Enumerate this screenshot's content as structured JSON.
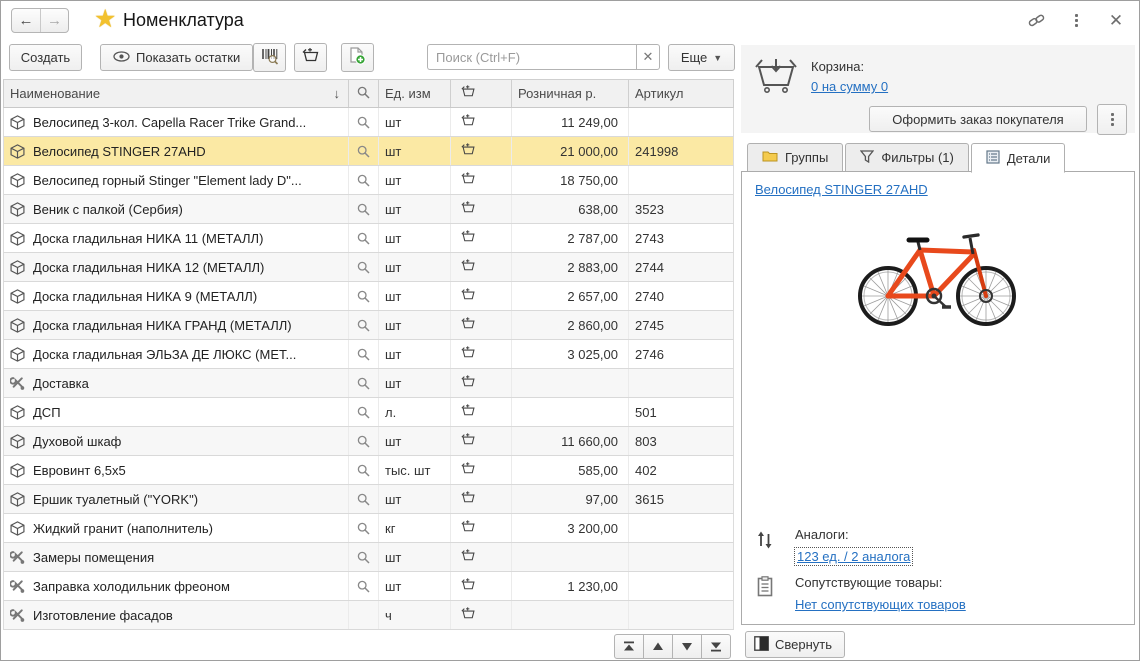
{
  "titlebar": {
    "title": "Номенклатура"
  },
  "toolbar": {
    "create_label": "Создать",
    "show_stock_label": "Показать остатки",
    "search_placeholder": "Поиск (Ctrl+F)",
    "search_value": "",
    "more_label": "Еще"
  },
  "table": {
    "headers": {
      "name": "Наименование",
      "unit": "Ед. изм",
      "price": "Розничная р.",
      "article": "Артикул"
    },
    "rows": [
      {
        "type": "good",
        "name": "Велосипед 3-кол. Capella Racer Trike Grand...",
        "unit": "шт",
        "price": "11 249,00",
        "article": "",
        "search": true,
        "selected": false
      },
      {
        "type": "good",
        "name": "Велосипед STINGER 27AHD",
        "unit": "шт",
        "price": "21 000,00",
        "article": "241998",
        "search": true,
        "selected": true
      },
      {
        "type": "good",
        "name": "Велосипед горный Stinger \"Element lady D\"...",
        "unit": "шт",
        "price": "18 750,00",
        "article": "",
        "search": true,
        "selected": false
      },
      {
        "type": "good",
        "name": "Веник с палкой (Сербия)",
        "unit": "шт",
        "price": "638,00",
        "article": "3523",
        "search": true,
        "selected": false
      },
      {
        "type": "good",
        "name": "Доска гладильная  НИКА 11 (МЕТАЛЛ)",
        "unit": "шт",
        "price": "2 787,00",
        "article": "2743",
        "search": true,
        "selected": false
      },
      {
        "type": "good",
        "name": "Доска гладильная  НИКА 12 (МЕТАЛЛ)",
        "unit": "шт",
        "price": "2 883,00",
        "article": "2744",
        "search": true,
        "selected": false
      },
      {
        "type": "good",
        "name": "Доска гладильная  НИКА 9 (МЕТАЛЛ)",
        "unit": "шт",
        "price": "2 657,00",
        "article": "2740",
        "search": true,
        "selected": false
      },
      {
        "type": "good",
        "name": "Доска гладильная  НИКА ГРАНД (МЕТАЛЛ)",
        "unit": "шт",
        "price": "2 860,00",
        "article": "2745",
        "search": true,
        "selected": false
      },
      {
        "type": "good",
        "name": "Доска гладильная  ЭЛЬЗА ДЕ ЛЮКС (МЕТ...",
        "unit": "шт",
        "price": "3 025,00",
        "article": "2746",
        "search": true,
        "selected": false
      },
      {
        "type": "service",
        "name": "Доставка",
        "unit": "шт",
        "price": "",
        "article": "",
        "search": true,
        "selected": false
      },
      {
        "type": "good",
        "name": "ДСП",
        "unit": "л.",
        "price": "",
        "article": "501",
        "search": true,
        "selected": false
      },
      {
        "type": "good",
        "name": "Духовой шкаф",
        "unit": "шт",
        "price": "11 660,00",
        "article": "803",
        "search": true,
        "selected": false
      },
      {
        "type": "good",
        "name": "Евровинт 6,5х5",
        "unit": "тыс. шт",
        "price": "585,00",
        "article": "402",
        "search": true,
        "selected": false
      },
      {
        "type": "good",
        "name": "Ершик туалетный (\"YORK\")",
        "unit": "шт",
        "price": "97,00",
        "article": "3615",
        "search": true,
        "selected": false
      },
      {
        "type": "good",
        "name": "Жидкий гранит (наполнитель)",
        "unit": "кг",
        "price": "3 200,00",
        "article": "",
        "search": true,
        "selected": false
      },
      {
        "type": "service",
        "name": "Замеры помещения",
        "unit": "шт",
        "price": "",
        "article": "",
        "search": true,
        "selected": false
      },
      {
        "type": "service",
        "name": "Заправка холодильник фреоном",
        "unit": "шт",
        "price": "1 230,00",
        "article": "",
        "search": true,
        "selected": false
      },
      {
        "type": "service",
        "name": "Изготовление фасадов",
        "unit": "ч",
        "price": "",
        "article": "",
        "search": false,
        "selected": false
      }
    ]
  },
  "cart": {
    "label": "Корзина:",
    "summary_link": "0 на сумму 0",
    "order_button": "Оформить заказ покупателя"
  },
  "tabs": {
    "groups": "Группы",
    "filters": "Фильтры (1)",
    "details": "Детали"
  },
  "details": {
    "product_link": "Велосипед STINGER 27AHD",
    "analogs_label": "Аналоги:",
    "analogs_link": "123 ед. / 2 аналога",
    "related_label": "Сопутствующие товары:",
    "related_link": "Нет сопутствующих товаров",
    "collapse_button": "Свернуть"
  },
  "colors": {
    "selection_yellow": "#fbe9a4",
    "link_blue": "#2470c2",
    "star_gold": "#f2c12e",
    "frame_orange": "#e8491c"
  }
}
